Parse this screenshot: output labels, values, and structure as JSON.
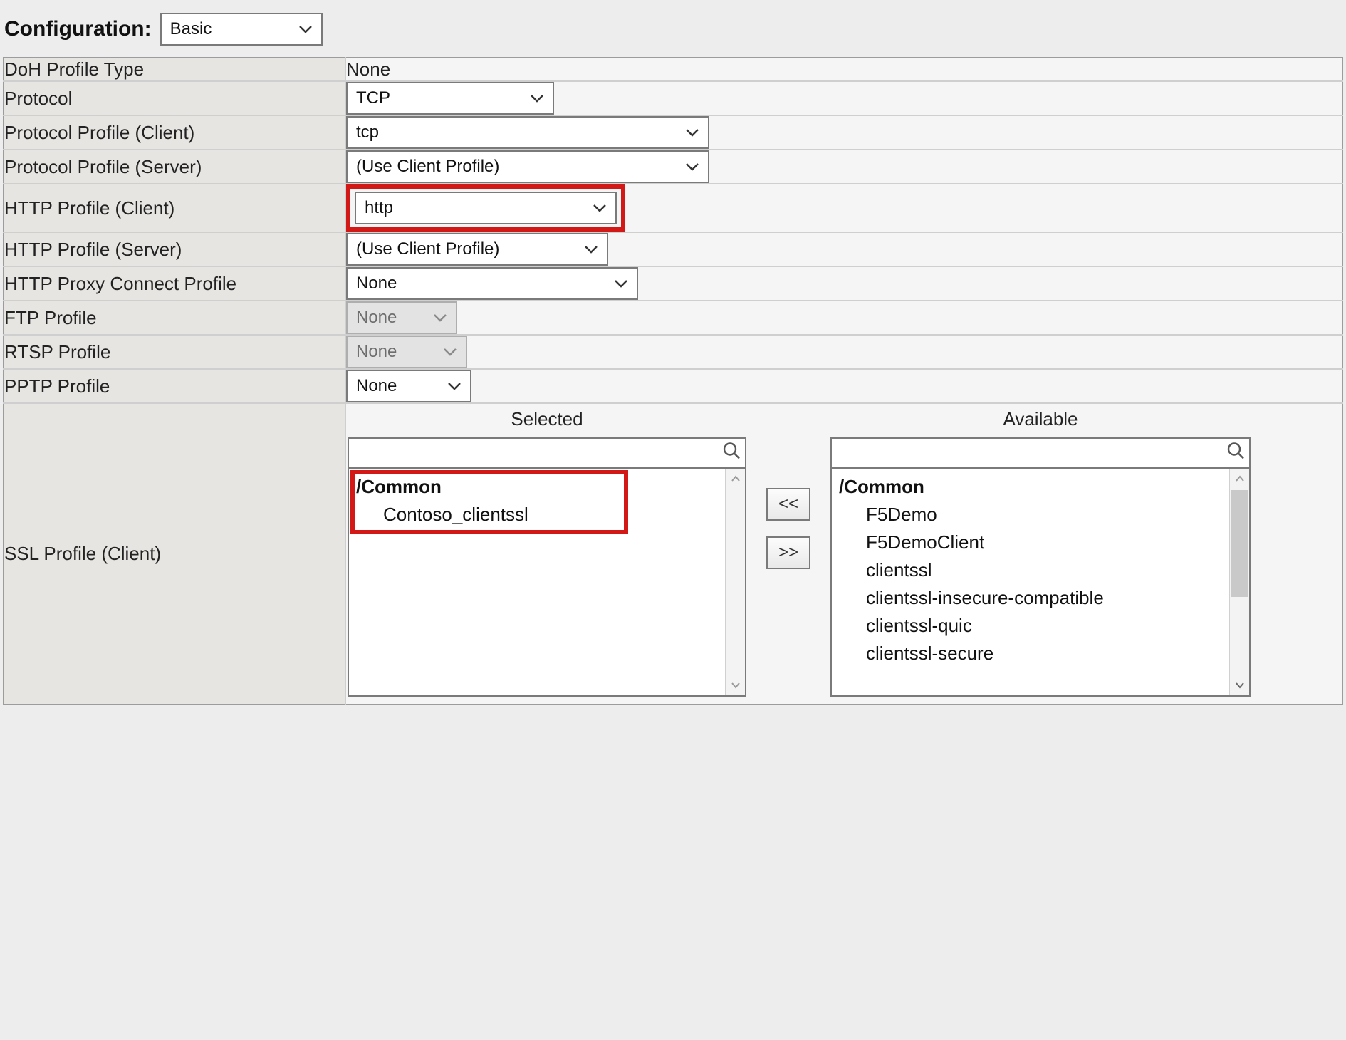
{
  "header": {
    "label": "Configuration:",
    "mode_value": "Basic"
  },
  "rows": {
    "doh_profile_type": {
      "label": "DoH Profile Type",
      "value": "None"
    },
    "protocol": {
      "label": "Protocol",
      "value": "TCP"
    },
    "protocol_profile_client": {
      "label": "Protocol Profile (Client)",
      "value": "tcp"
    },
    "protocol_profile_server": {
      "label": "Protocol Profile (Server)",
      "value": "(Use Client Profile)"
    },
    "http_profile_client": {
      "label": "HTTP Profile (Client)",
      "value": "http"
    },
    "http_profile_server": {
      "label": "HTTP Profile (Server)",
      "value": "(Use Client Profile)"
    },
    "http_proxy_connect": {
      "label": "HTTP Proxy Connect Profile",
      "value": "None"
    },
    "ftp_profile": {
      "label": "FTP Profile",
      "value": "None"
    },
    "rtsp_profile": {
      "label": "RTSP Profile",
      "value": "None"
    },
    "pptp_profile": {
      "label": "PPTP Profile",
      "value": "None"
    },
    "ssl_profile_client": {
      "label": "SSL Profile (Client)"
    }
  },
  "ssl_client": {
    "selected_title": "Selected",
    "available_title": "Available",
    "selected_group": "/Common",
    "selected_items": [
      "Contoso_clientssl"
    ],
    "available_group": "/Common",
    "available_items": [
      "F5Demo",
      "F5DemoClient",
      "clientssl",
      "clientssl-insecure-compatible",
      "clientssl-quic",
      "clientssl-secure"
    ],
    "move_left": "<<",
    "move_right": ">>"
  }
}
